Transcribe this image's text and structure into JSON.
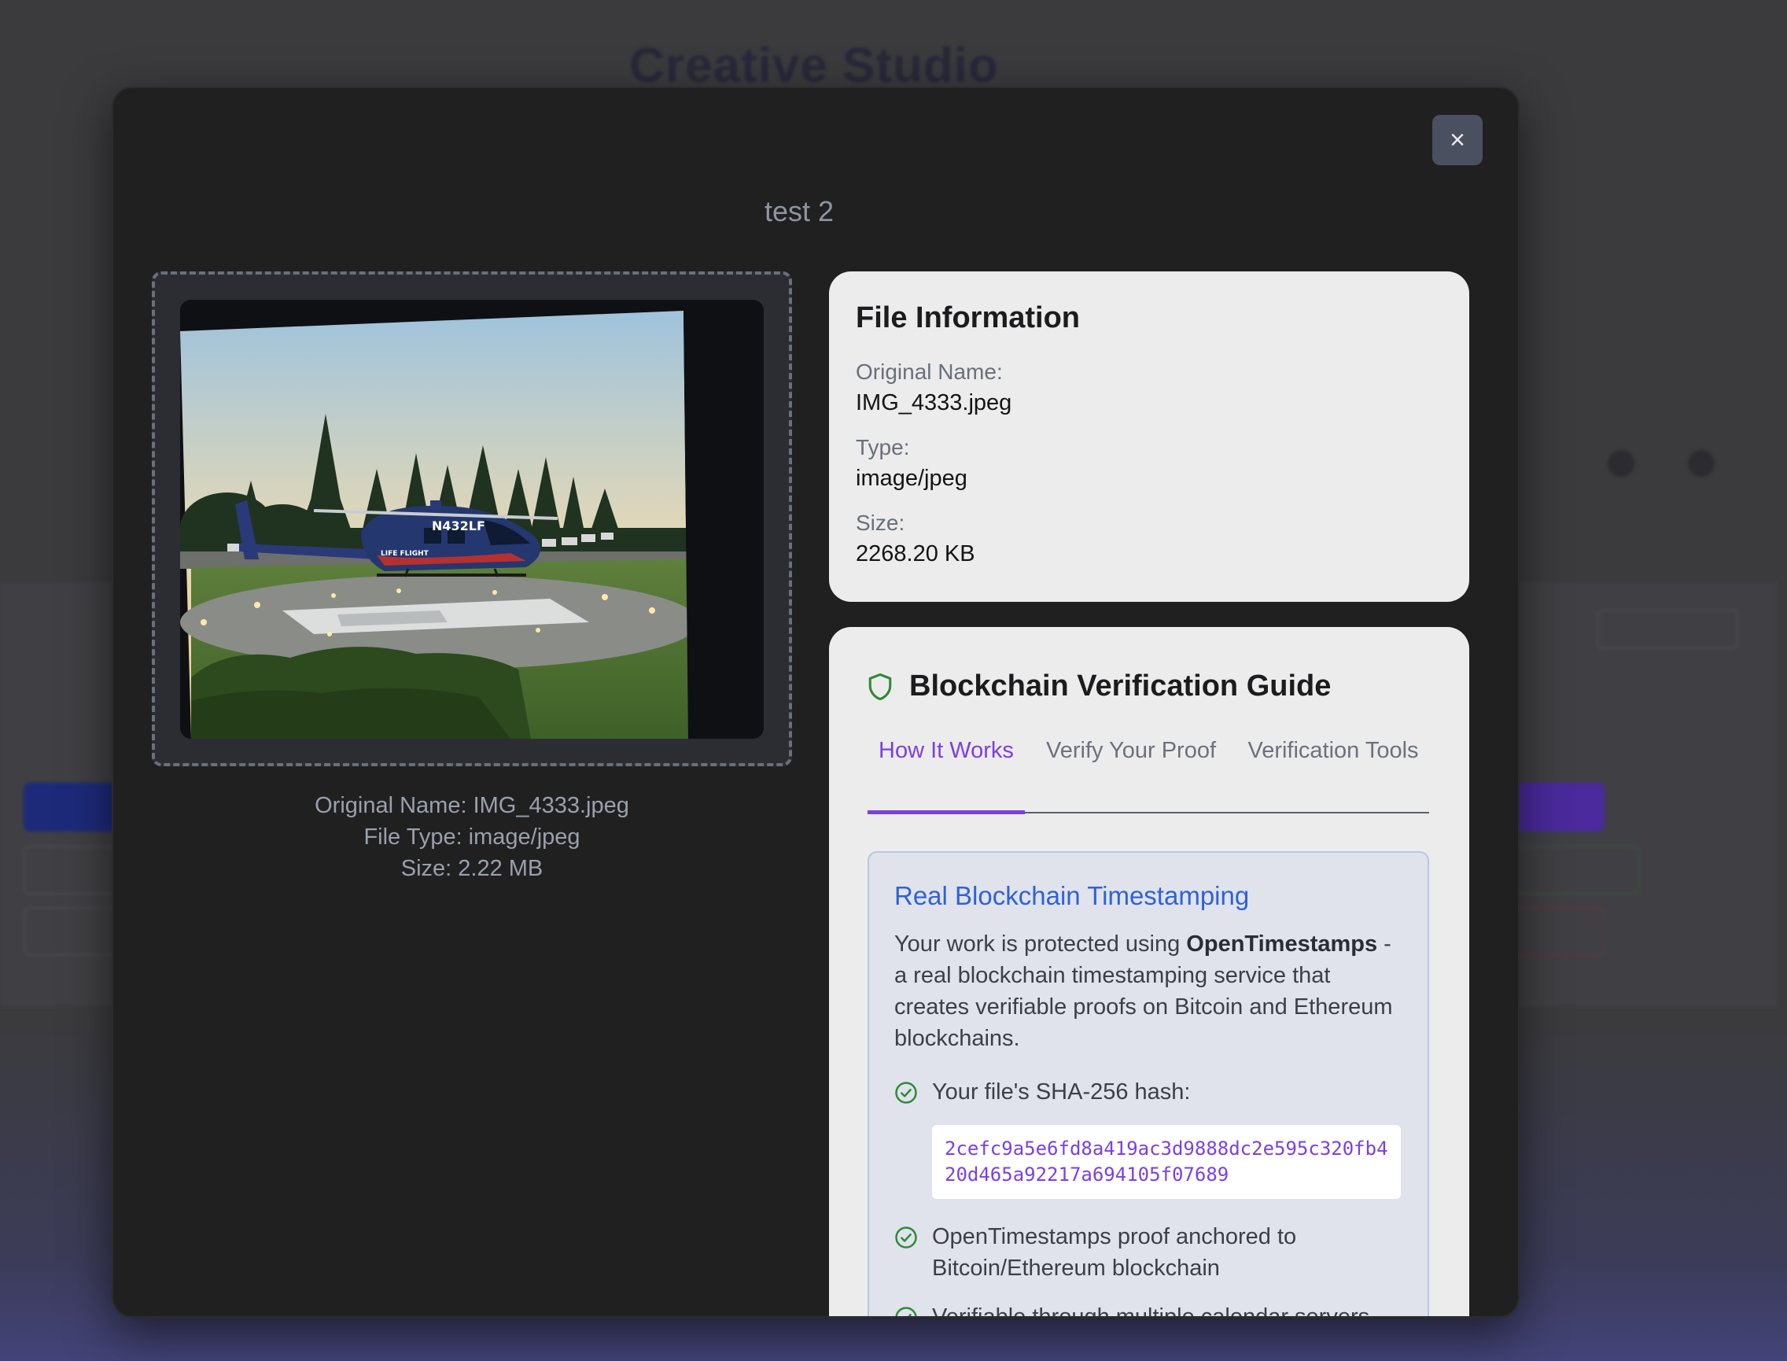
{
  "background": {
    "app_title": "Creative Studio"
  },
  "modal": {
    "close_label": "×",
    "title": "test 2",
    "image_alt": "helicopter photo",
    "caption": {
      "original_name": "Original Name: IMG_4333.jpeg",
      "file_type": "File Type: image/jpeg",
      "size": "Size: 2.22 MB"
    },
    "file_info": {
      "heading": "File Information",
      "original_name_label": "Original Name:",
      "original_name_value": "IMG_4333.jpeg",
      "type_label": "Type:",
      "type_value": "image/jpeg",
      "size_label": "Size:",
      "size_value": "2268.20 KB"
    },
    "guide": {
      "heading": "Blockchain Verification Guide",
      "icon": "shield-icon",
      "tabs": [
        {
          "label": "How It Works",
          "active": true
        },
        {
          "label": "Verify Your Proof",
          "active": false
        },
        {
          "label": "Verification Tools",
          "active": false
        }
      ],
      "panel": {
        "title": "Real Blockchain Timestamping",
        "desc_prefix": "Your work is protected using ",
        "desc_strong": "OpenTimestamps",
        "desc_suffix": " - a real blockchain timestamping service that creates verifiable proofs on Bitcoin and Ethereum blockchains.",
        "items": [
          "Your file's SHA-256 hash:",
          "OpenTimestamps proof anchored to Bitcoin/Ethereum blockchain",
          "Verifiable through multiple calendar servers"
        ],
        "hash": "2cefc9a5e6fd8a419ac3d9888dc2e595c320fb420d465a92217a694105f07689"
      }
    }
  },
  "colors": {
    "accent": "#7b3fe4",
    "link_blue": "#2f62d6",
    "check_green": "#2e8b3a"
  }
}
